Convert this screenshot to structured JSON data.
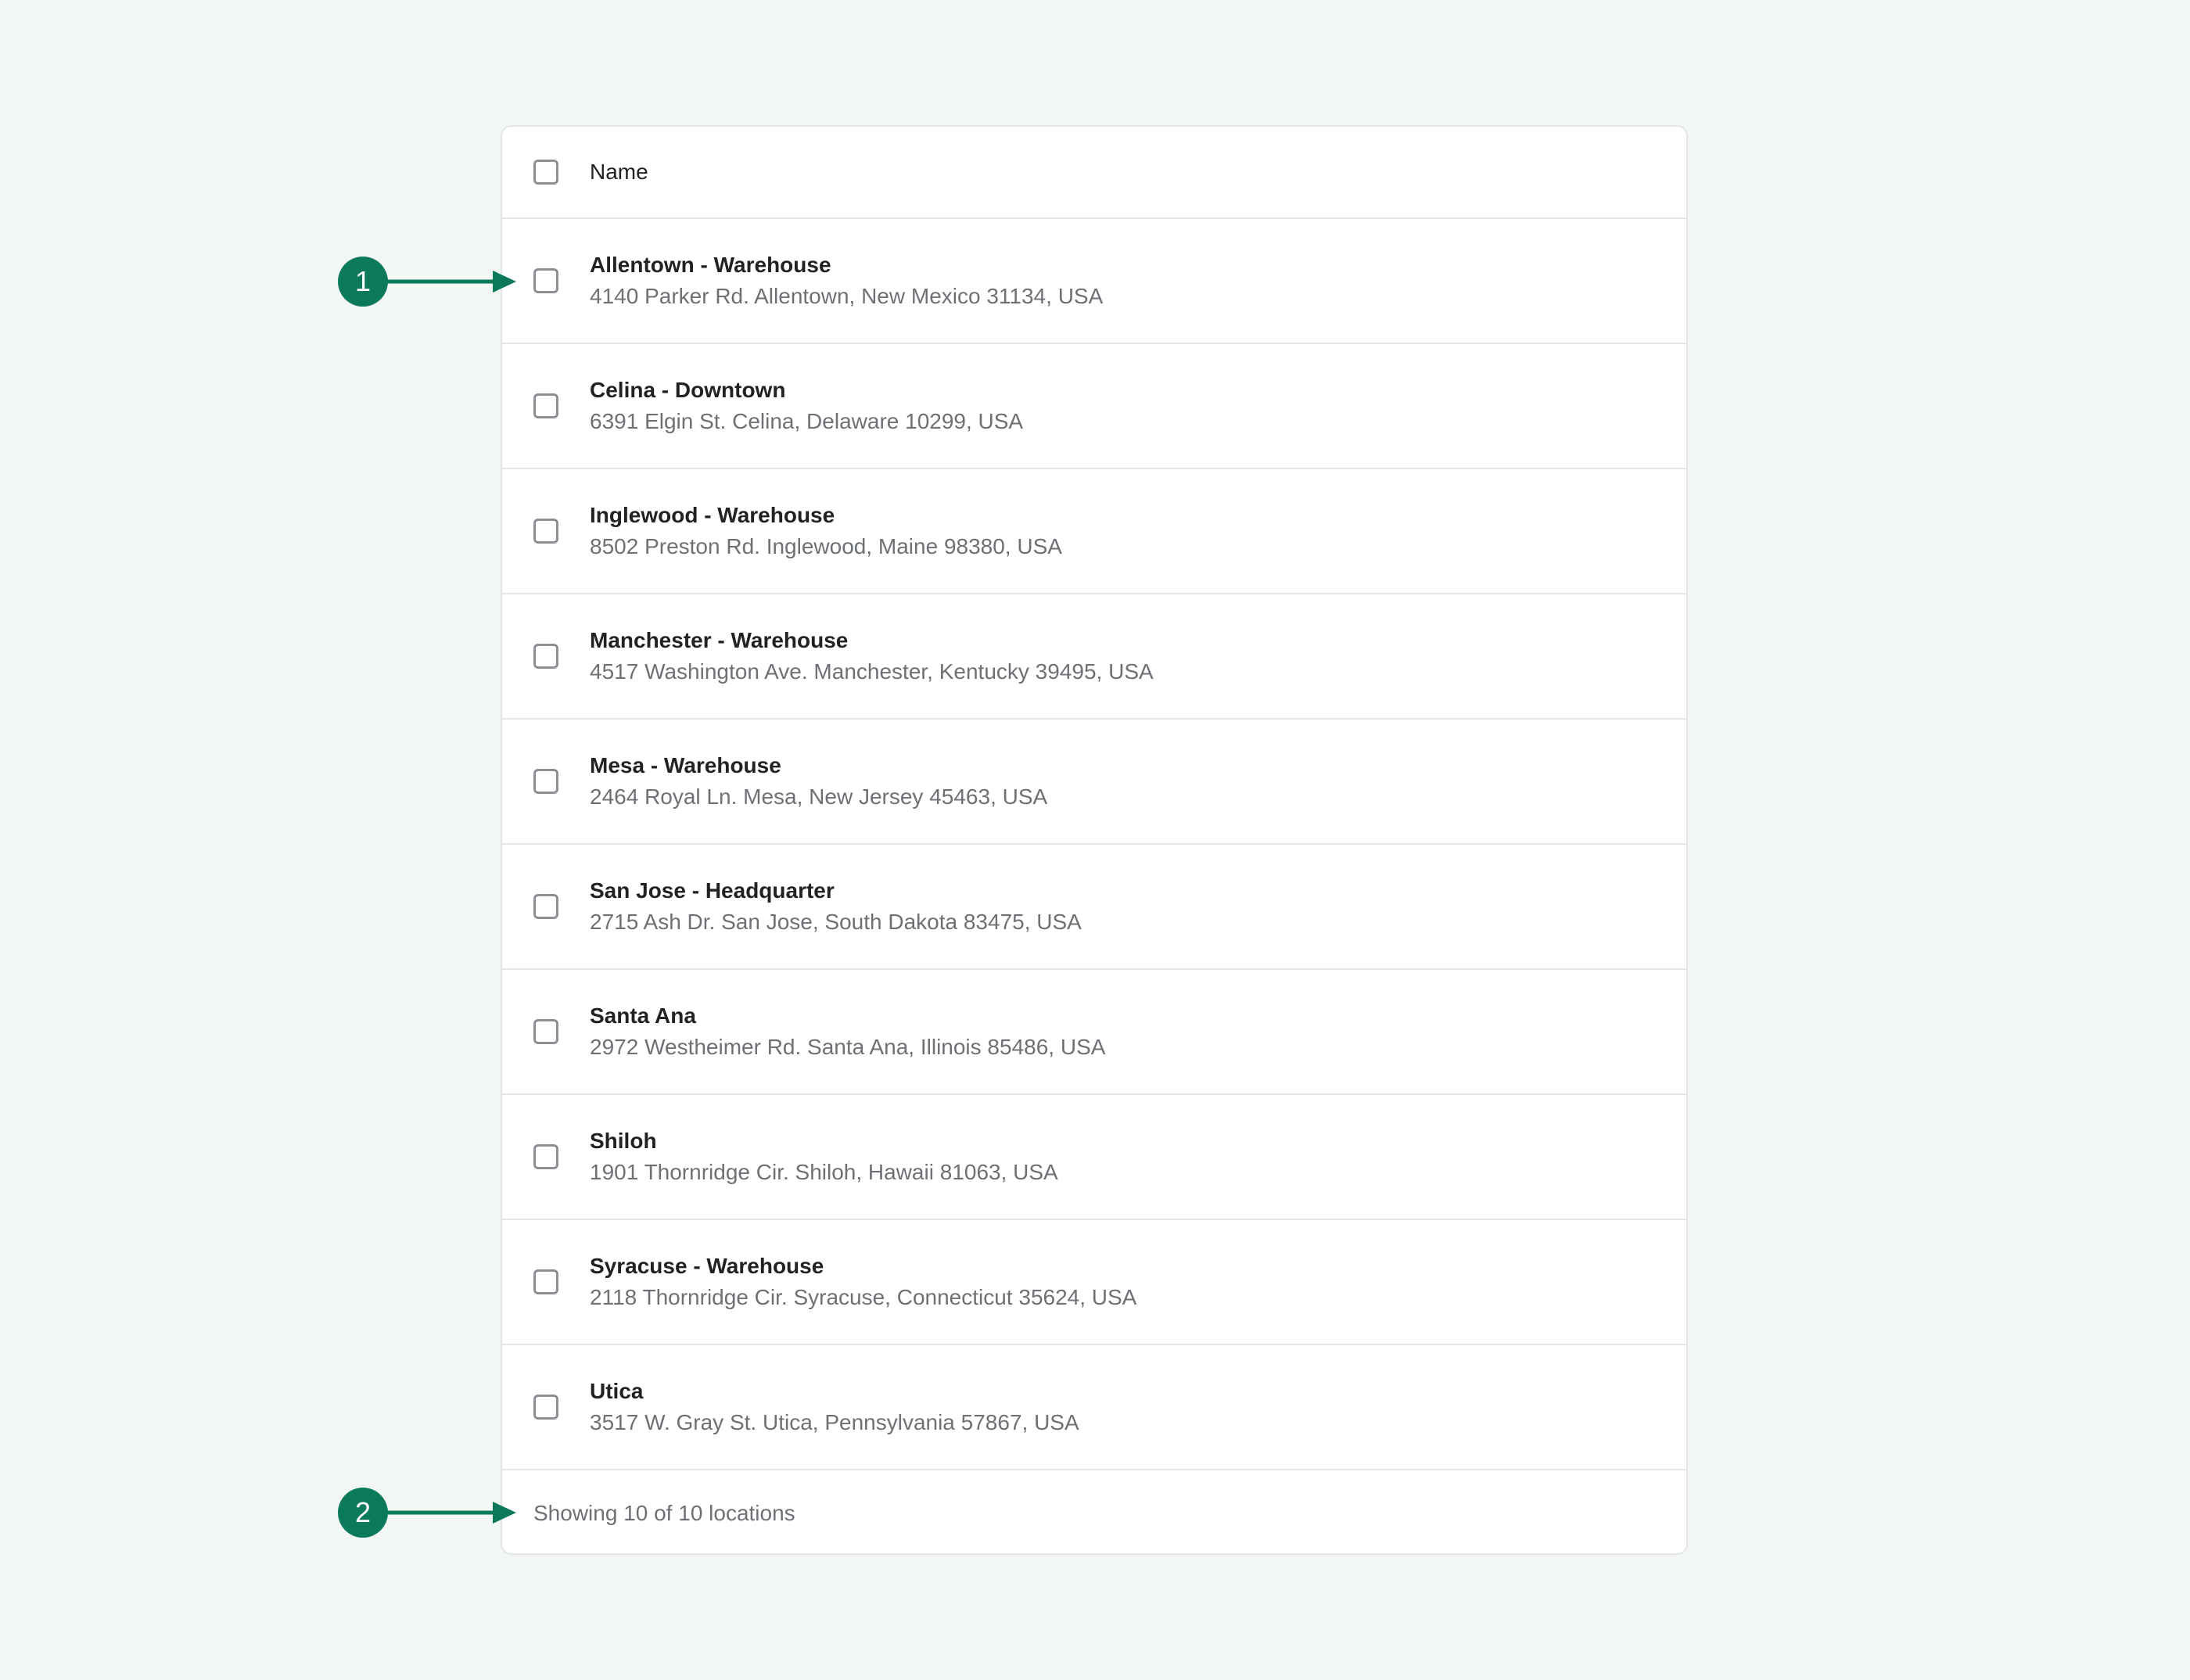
{
  "table": {
    "header_label": "Name",
    "rows": [
      {
        "name": "Allentown - Warehouse",
        "address": "4140 Parker Rd. Allentown, New Mexico 31134, USA"
      },
      {
        "name": "Celina - Downtown",
        "address": "6391 Elgin St. Celina, Delaware 10299, USA"
      },
      {
        "name": "Inglewood - Warehouse",
        "address": "8502 Preston Rd. Inglewood, Maine 98380, USA"
      },
      {
        "name": "Manchester - Warehouse",
        "address": "4517 Washington Ave. Manchester, Kentucky 39495, USA"
      },
      {
        "name": "Mesa - Warehouse",
        "address": "2464 Royal Ln. Mesa, New Jersey 45463, USA"
      },
      {
        "name": "San Jose - Headquarter",
        "address": "2715 Ash Dr. San Jose, South Dakota 83475, USA"
      },
      {
        "name": "Santa Ana",
        "address": "2972 Westheimer Rd. Santa Ana, Illinois 85486, USA"
      },
      {
        "name": "Shiloh",
        "address": "1901 Thornridge Cir. Shiloh, Hawaii 81063, USA"
      },
      {
        "name": "Syracuse - Warehouse",
        "address": "2118 Thornridge Cir. Syracuse, Connecticut 35624, USA"
      },
      {
        "name": "Utica",
        "address": "3517 W. Gray St. Utica, Pennsylvania 57867, USA"
      }
    ],
    "footer_text": "Showing 10 of 10 locations"
  },
  "callouts": [
    {
      "label": "1"
    },
    {
      "label": "2"
    }
  ],
  "colors": {
    "accent": "#0b7a5a",
    "background": "#f2f7f4"
  }
}
